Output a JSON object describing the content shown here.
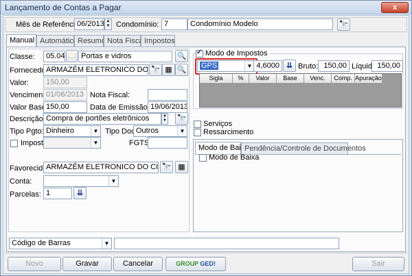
{
  "window": {
    "title": "Lançamento de Contas a Pagar",
    "close_label": "x"
  },
  "header": {
    "mes_label": "Mês de Referência:",
    "mes_value": "06/2013",
    "condominio_label": "Condomínio:",
    "condominio_code": "7",
    "condominio_name": "Condomínio Modelo"
  },
  "tabs": [
    "Manual",
    "Automático",
    "Resumo",
    "Nota Fiscal",
    "Impostos"
  ],
  "form": {
    "classe_label": "Classe:",
    "classe_code": "05.04",
    "classe_name": "Portas e vidros",
    "fornecedor_label": "Fornecedor:",
    "fornecedor_value": "ARMAZÉM ELETRONICO DO CICERO",
    "valor_label": "Valor:",
    "valor_value": "150,00",
    "vencimento_label": "Vencimento:",
    "vencimento_value": "01/06/2013",
    "nota_fiscal_label": "Nota Fiscal:",
    "nota_fiscal_value": "",
    "valor_base_label": "Valor Base:",
    "valor_base_value": "150,00",
    "data_emissao_label": "Data de Emissão NF:",
    "data_emissao_value": "19/06/2013",
    "descricao_label": "Descrição:",
    "descricao_value": "Compra de portões eletrônicos",
    "tipo_pgto_label": "Tipo Pgto:",
    "tipo_pgto_value": "Dinheiro",
    "tipo_doc_label": "Tipo Doc:",
    "tipo_doc_value": "Outros",
    "imposto_label": "Imposto",
    "fgts_label": "FGTS:",
    "favorecido_label": "Favorecido:",
    "favorecido_value": "ARMAZÉM ELETRONICO DO CICERO",
    "conta_label": "Conta:",
    "conta_value": "",
    "parcelas_label": "Parcelas:",
    "parcelas_value": "1",
    "codigo_barras_value": "Código de Barras",
    "codigo_barras_input": ""
  },
  "impostos": {
    "modo_label": "Modo de Impostos",
    "tipo_value": "GPS",
    "aliquota_value": "4,6000",
    "bruto_label": "Bruto:",
    "bruto_value": "150,00",
    "liquido_label": "Líquido:",
    "liquido_value": "150,00",
    "columns": [
      "Sigla",
      "%",
      "Valor",
      "Base",
      "Venc.",
      "Comp.",
      "Apuração"
    ]
  },
  "options": {
    "servicos_label": "Serviços",
    "ressarcimento_label": "Ressarcimento"
  },
  "subtabs": [
    "Modo de Baixa",
    "Pendência/Controle de Documentos"
  ],
  "modo_baixa_label": "Modo de Baixa",
  "buttons": {
    "novo": "Novo",
    "gravar": "Gravar",
    "cancelar": "Cancelar",
    "logo_group": "GROUP",
    "logo_ged": "GED",
    "sair": "Sair"
  },
  "icons": {
    "binoculars": "binoculars-icon",
    "folder": "folder-icon",
    "search": "search-icon",
    "calculator": "calculator-icon",
    "arrows": "down-arrows-icon"
  }
}
